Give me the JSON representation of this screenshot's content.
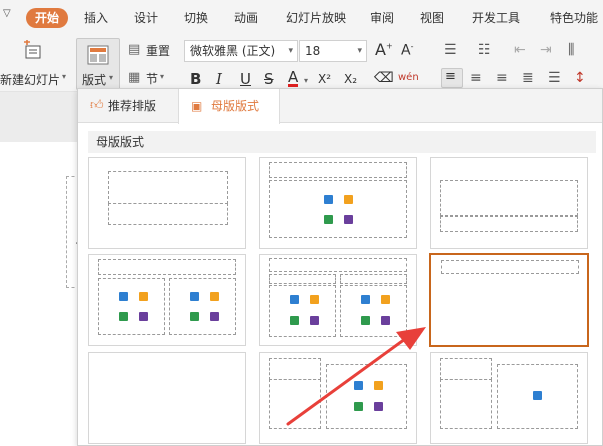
{
  "ribbon": {
    "tabs": [
      {
        "label": "开始",
        "active": true
      },
      {
        "label": "插入"
      },
      {
        "label": "设计"
      },
      {
        "label": "切换"
      },
      {
        "label": "动画"
      },
      {
        "label": "幻灯片放映"
      },
      {
        "label": "审阅"
      },
      {
        "label": "视图"
      },
      {
        "label": "开发工具"
      },
      {
        "label": "特色功能"
      }
    ],
    "accent": "#e07a3f"
  },
  "toolbar": {
    "new_slide": "新建幻灯片",
    "layout": "版式",
    "reset": "重置",
    "section": "节",
    "font_name": "微软雅黑 (正文)",
    "font_size": "18",
    "grow_font": "A",
    "shrink_font": "A",
    "bold": "B",
    "italic": "I",
    "underline": "U",
    "strike": "S",
    "font_color": "A",
    "superscript": "X²",
    "subscript": "X₂",
    "clear": "⌫",
    "phonetic": "wén"
  },
  "layout_panel": {
    "tabs": [
      {
        "label": "推荐排版"
      },
      {
        "label": "母版版式",
        "active": true
      }
    ],
    "section_title": "母版版式",
    "selected_color": "#c8661c",
    "layouts": [
      {
        "name": "title-slide"
      },
      {
        "name": "title-and-content"
      },
      {
        "name": "section-header"
      },
      {
        "name": "two-content"
      },
      {
        "name": "comparison"
      },
      {
        "name": "title-only",
        "selected": true
      },
      {
        "name": "blank"
      },
      {
        "name": "content-with-caption"
      },
      {
        "name": "picture-with-caption"
      }
    ]
  },
  "annotation": {
    "arrow_color": "#e8403a"
  }
}
